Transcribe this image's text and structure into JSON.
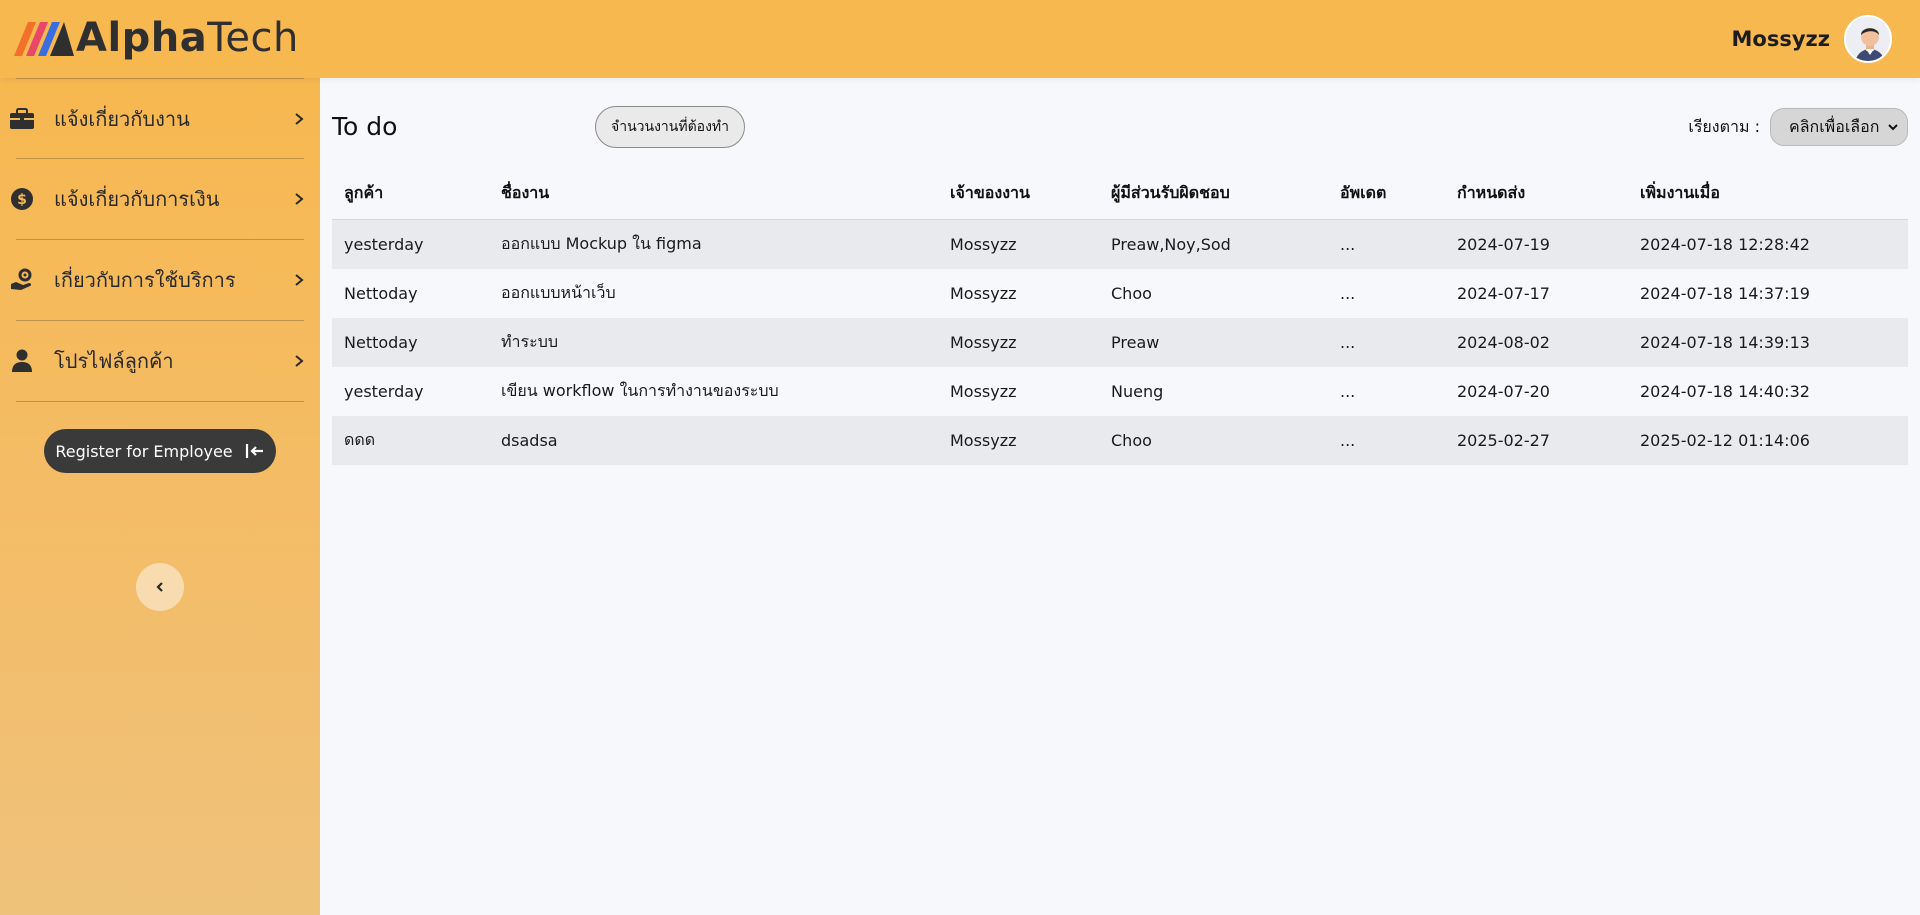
{
  "brand": {
    "part1": "Alpha",
    "part2": "Tech"
  },
  "user": {
    "name": "Mossyzz"
  },
  "sidebar": {
    "items": [
      {
        "label": "แจ้งเกี่ยวกับงาน",
        "icon": "briefcase-icon"
      },
      {
        "label": "แจ้งเกี่ยวกับการเงิน",
        "icon": "dollar-coin-icon"
      },
      {
        "label": "เกี่ยวกับการใช้บริการ",
        "icon": "service-hand-gear-icon"
      },
      {
        "label": "โปรไฟล์ลูกค้า",
        "icon": "user-icon"
      }
    ],
    "register_label": "Register for Employee"
  },
  "main": {
    "title": "To do",
    "count_button": "จำนวนงานที่ต้องทำ",
    "sort_label": "เรียงตาม :",
    "sort_value": "คลิกเพื่อเลือก"
  },
  "table": {
    "headers": [
      "ลูกค้า",
      "ชื่องาน",
      "เจ้าของงาน",
      "ผู้มีส่วนรับผิดชอบ",
      "อัพเดต",
      "กำหนดส่ง",
      "เพิ่มงานเมื่อ"
    ],
    "rows": [
      [
        "yesterday",
        "ออกแบบ Mockup ใน figma",
        "Mossyzz",
        "Preaw,Noy,Sod",
        "...",
        "2024-07-19",
        "2024-07-18 12:28:42"
      ],
      [
        "Nettoday",
        "ออกแบบหน้าเว็บ",
        "Mossyzz",
        "Choo",
        "...",
        "2024-07-17",
        "2024-07-18 14:37:19"
      ],
      [
        "Nettoday",
        "ทำระบบ",
        "Mossyzz",
        "Preaw",
        "...",
        "2024-08-02",
        "2024-07-18 14:39:13"
      ],
      [
        "yesterday",
        "เขียน workflow ในการทำงานของระบบ",
        "Mossyzz",
        "Nueng",
        "...",
        "2024-07-20",
        "2024-07-18 14:40:32"
      ],
      [
        "ดดด",
        "dsadsa",
        "Mossyzz",
        "Choo",
        "...",
        "2025-02-27",
        "2025-02-12 01:14:06"
      ]
    ]
  },
  "colors": {
    "header": "#f7b850",
    "sidebar": "#f3bd6a",
    "register_button": "#3a3a3a",
    "row_alt": "#e9eaee"
  }
}
